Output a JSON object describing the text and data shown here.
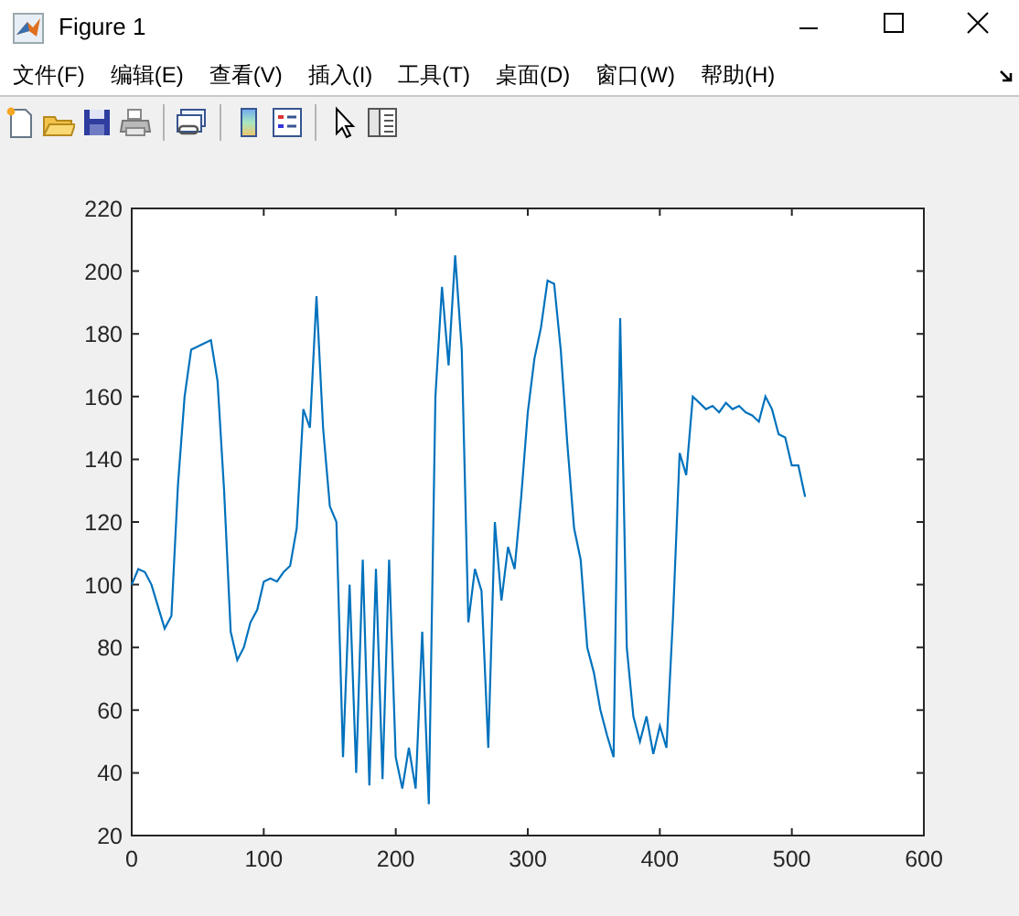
{
  "window": {
    "title": "Figure 1"
  },
  "menu": [
    "文件(F)",
    "编辑(E)",
    "查看(V)",
    "插入(I)",
    "工具(T)",
    "桌面(D)",
    "窗口(W)",
    "帮助(H)"
  ],
  "toolbar": [
    {
      "kind": "new"
    },
    {
      "kind": "open"
    },
    {
      "kind": "save"
    },
    {
      "kind": "print"
    },
    {
      "kind": "separator"
    },
    {
      "kind": "link"
    },
    {
      "kind": "separator"
    },
    {
      "kind": "colorbar"
    },
    {
      "kind": "legend"
    },
    {
      "kind": "separator"
    },
    {
      "kind": "pointer"
    },
    {
      "kind": "inspector"
    }
  ],
  "chart_data": {
    "type": "line",
    "xlim": [
      0,
      600
    ],
    "ylim": [
      20,
      220
    ],
    "xticks": [
      0,
      100,
      200,
      300,
      400,
      500,
      600
    ],
    "yticks": [
      20,
      40,
      60,
      80,
      100,
      120,
      140,
      160,
      180,
      200,
      220
    ],
    "x": [
      0,
      5,
      10,
      15,
      20,
      25,
      30,
      35,
      40,
      45,
      50,
      55,
      60,
      65,
      70,
      75,
      80,
      85,
      90,
      95,
      100,
      105,
      110,
      115,
      120,
      125,
      130,
      135,
      140,
      145,
      150,
      155,
      160,
      165,
      170,
      175,
      180,
      185,
      190,
      195,
      200,
      205,
      210,
      215,
      220,
      225,
      230,
      235,
      240,
      245,
      250,
      255,
      260,
      265,
      270,
      275,
      280,
      285,
      290,
      295,
      300,
      305,
      310,
      315,
      320,
      325,
      330,
      335,
      340,
      345,
      350,
      355,
      360,
      365,
      370,
      375,
      380,
      385,
      390,
      395,
      400,
      405,
      410,
      415,
      420,
      425,
      430,
      435,
      440,
      445,
      450,
      455,
      460,
      465,
      470,
      475,
      480,
      485,
      490,
      495,
      500,
      505,
      510
    ],
    "series": [
      {
        "color": "#0072bd",
        "values": [
          100,
          105,
          104,
          100,
          93,
          86,
          90,
          132,
          160,
          175,
          176,
          177,
          178,
          165,
          130,
          85,
          76,
          80,
          88,
          92,
          101,
          102,
          101,
          104,
          106,
          118,
          156,
          150,
          192,
          150,
          125,
          120,
          45,
          100,
          40,
          108,
          36,
          105,
          38,
          108,
          45,
          35,
          48,
          35,
          85,
          30,
          160,
          195,
          170,
          205,
          175,
          88,
          105,
          98,
          48,
          120,
          95,
          112,
          105,
          128,
          155,
          172,
          182,
          197,
          196,
          175,
          145,
          118,
          108,
          80,
          72,
          60,
          52,
          45,
          185,
          80,
          58,
          50,
          58,
          46,
          55,
          48,
          90,
          142,
          135,
          160,
          158,
          156,
          157,
          155,
          158,
          156,
          157,
          155,
          154,
          152,
          160,
          156,
          148,
          147,
          138,
          138,
          128
        ]
      }
    ]
  }
}
